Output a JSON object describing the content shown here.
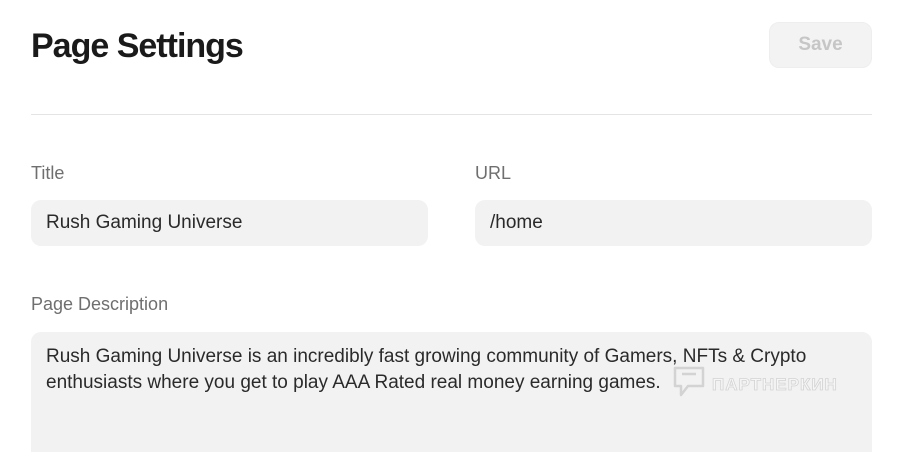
{
  "header": {
    "title": "Page Settings",
    "save_label": "Save"
  },
  "form": {
    "title_label": "Title",
    "title_value": "Rush Gaming Universe",
    "url_label": "URL",
    "url_value": "/home",
    "description_label": "Page Description",
    "description_value": "Rush Gaming Universe is an incredibly fast growing community of Gamers, NFTs & Crypto enthusiasts where you get to play AAA Rated real money earning games."
  },
  "watermark": {
    "text": "ПАРТНЕРКИН",
    "icon": "partnerkin-logo-icon"
  },
  "colors": {
    "input_bg": "#f2f2f2",
    "save_disabled_text": "#c6c6c6",
    "label_text": "#6f6f6f"
  }
}
